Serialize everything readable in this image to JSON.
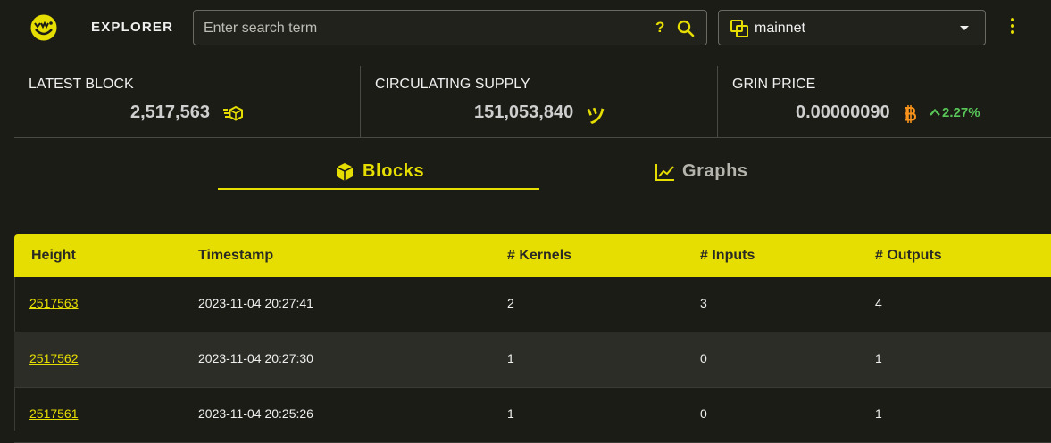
{
  "header": {
    "brand": "EXPLORER",
    "search_placeholder": "Enter search term",
    "search_help": "?",
    "network": "mainnet",
    "icons": [
      "grin-logo-icon",
      "help-icon",
      "search-icon",
      "network-icon",
      "chevron-down-icon",
      "more-vert-icon"
    ]
  },
  "stats": {
    "latest_block": {
      "title": "LATEST BLOCK",
      "value": "2,517,563"
    },
    "circulating_supply": {
      "title": "CIRCULATING SUPPLY",
      "value": "151,053,840",
      "unit": "ツ"
    },
    "grin_price": {
      "title": "GRIN PRICE",
      "value": "0.00000090",
      "change": "2.27%"
    }
  },
  "tabs": [
    {
      "label": "Blocks",
      "active": true
    },
    {
      "label": "Graphs",
      "active": false
    }
  ],
  "table": {
    "columns": [
      "Height",
      "Timestamp",
      "# Kernels",
      "# Inputs",
      "# Outputs"
    ],
    "rows": [
      {
        "height": "2517563",
        "timestamp": "2023-11-04 20:27:41",
        "kernels": "2",
        "inputs": "3",
        "outputs": "4"
      },
      {
        "height": "2517562",
        "timestamp": "2023-11-04 20:27:30",
        "kernels": "1",
        "inputs": "0",
        "outputs": "1"
      },
      {
        "height": "2517561",
        "timestamp": "2023-11-04 20:25:26",
        "kernels": "1",
        "inputs": "0",
        "outputs": "1"
      }
    ]
  },
  "colors": {
    "accent": "#e6de00",
    "background": "#1c1c17",
    "positive": "#58c758",
    "bitcoin": "#f7931a"
  }
}
